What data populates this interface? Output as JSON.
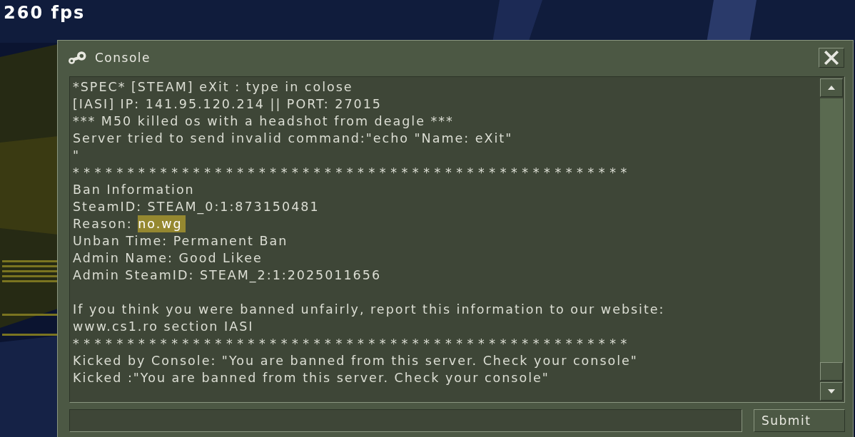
{
  "hud": {
    "fps": "260 fps"
  },
  "window": {
    "title": "Console"
  },
  "log": [
    {
      "kind": "text",
      "text": "*SPEC* [STEAM] eXit : type in colose"
    },
    {
      "kind": "text",
      "text": "[IASI] IP: 141.95.120.214 || PORT: 27015"
    },
    {
      "kind": "text",
      "text": "*** M50 killed os with a headshot from deagle ***"
    },
    {
      "kind": "text",
      "text": "Server tried to send invalid command:\"echo \"Name: eXit\""
    },
    {
      "kind": "text",
      "text": "\""
    },
    {
      "kind": "separator",
      "text": "***************************************************"
    },
    {
      "kind": "text",
      "text": "Ban Information"
    },
    {
      "kind": "text",
      "text": "SteamID: STEAM_0:1:873150481"
    },
    {
      "kind": "selection",
      "text": "Reason: ",
      "selected_text": "no.wg"
    },
    {
      "kind": "text",
      "text": "Unban Time: Permanent Ban"
    },
    {
      "kind": "text",
      "text": "Admin Name: Good Likee"
    },
    {
      "kind": "text",
      "text": "Admin SteamID: STEAM_2:1:2025011656"
    },
    {
      "kind": "blank"
    },
    {
      "kind": "text",
      "text": "If you think you were banned unfairly, report this information to our website:"
    },
    {
      "kind": "text",
      "text": "www.cs1.ro section IASI"
    },
    {
      "kind": "separator",
      "text": "***************************************************"
    },
    {
      "kind": "text",
      "text": "Kicked by Console: \"You are banned from this server. Check your console\""
    },
    {
      "kind": "text",
      "text": "Kicked :\"You are banned from this server. Check your console\""
    }
  ],
  "submit": "Submit"
}
